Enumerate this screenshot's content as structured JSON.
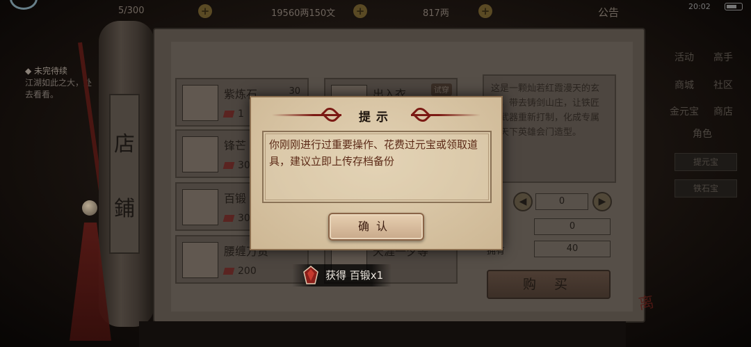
{
  "topbar": {
    "res1": "5/300",
    "res2": "19560两150文",
    "res3": "817两",
    "announcement": "公告",
    "clock": "20:02"
  },
  "quest": {
    "header": "◆ 未完待续",
    "body": "江湖如此之大，处去看看。"
  },
  "shop": {
    "title_chars": [
      "店",
      "鋪"
    ],
    "items": [
      {
        "name": "紫炼石",
        "qty": "30",
        "price": "1",
        "tag": ""
      },
      {
        "name": "出入衣",
        "qty": "",
        "price": "",
        "tag": "试穿"
      },
      {
        "name": "锋芒",
        "qty": "",
        "price": "30",
        "tag": ""
      },
      {
        "name": "百锻",
        "qty": "",
        "price": "30",
        "tag": ""
      },
      {
        "name": "腰缠万贯",
        "qty": "",
        "price": "200",
        "tag": ""
      },
      {
        "name": "天涯一夕等",
        "qty": "",
        "price": "",
        "tag": ""
      }
    ],
    "description": "这是一颗灿若红霞漫天的玄石，带去铸剑山庄，让铁匠将武器重新打制，化成专属的天下英雄会门造型。",
    "quantity_value": "0",
    "cost_label": "费",
    "cost_value": "0",
    "own_label": "拥有",
    "own_value": "40",
    "buy_label": "购 买",
    "colors": {
      "gem": "#5a2421"
    }
  },
  "right_nav": {
    "row1": [
      "活动",
      "高手"
    ],
    "row2": [
      "商城",
      "社区"
    ],
    "row3": [
      "金元宝",
      "商店"
    ],
    "tab_selected": "角色",
    "btn1": "提元宝",
    "btn2": "铁石宝"
  },
  "dialog": {
    "title": "提示",
    "message": "你刚刚进行过重要操作、花费过元宝或领取道具，建议立即上传存档备份",
    "confirm": "确认"
  },
  "toast": {
    "text": "获得 百锻x1"
  },
  "seal": "离"
}
